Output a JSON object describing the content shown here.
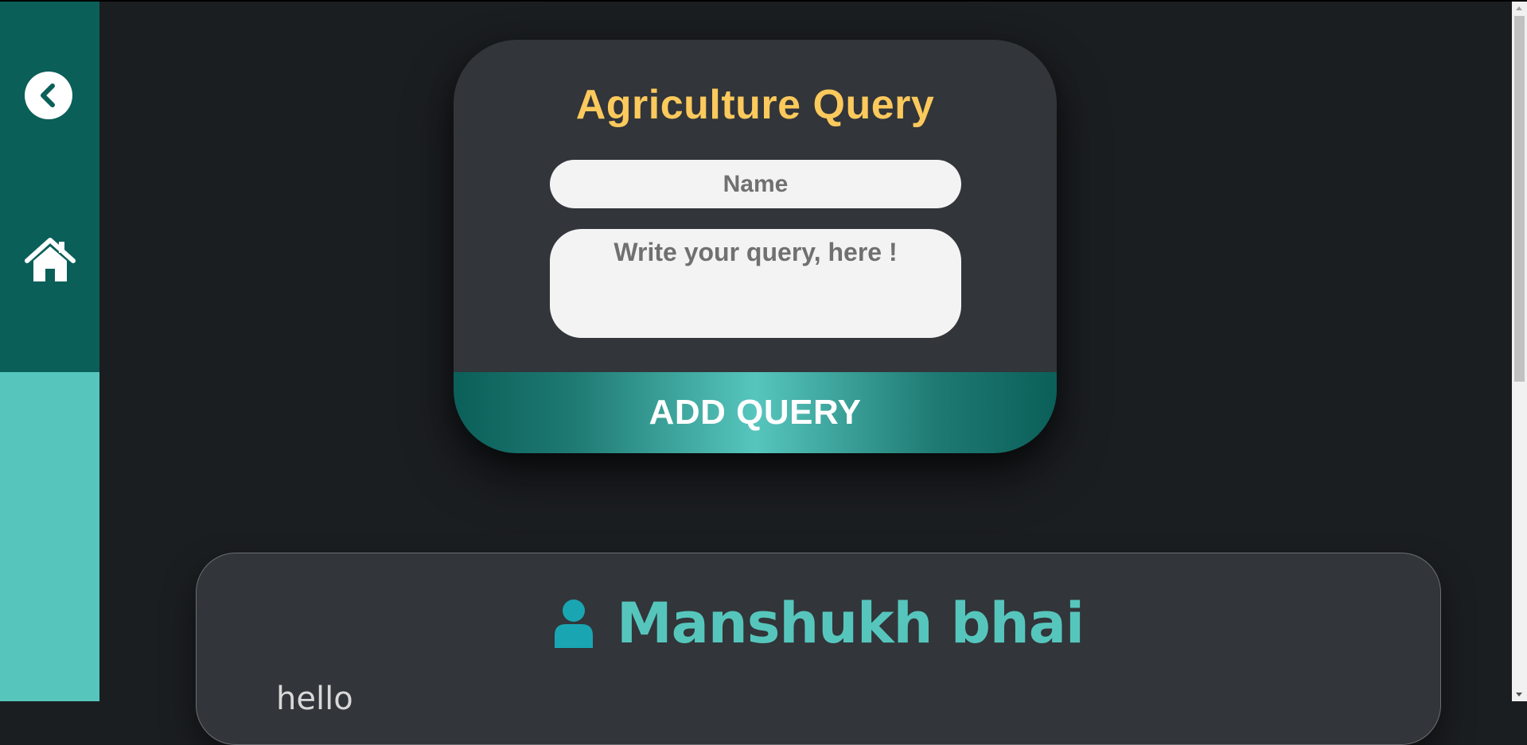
{
  "sidebar": {
    "back_icon": "chevron-left-circle-icon",
    "home_icon": "home-icon"
  },
  "form": {
    "title": "Agriculture Query",
    "name_placeholder": "Name",
    "query_placeholder": "Write your query, here !",
    "submit_label": "ADD QUERY"
  },
  "queries": [
    {
      "user_name": "Manshukh bhai",
      "text": "hello"
    }
  ],
  "colors": {
    "background": "#1b1e21",
    "sidebar_dark": "#0b5f59",
    "sidebar_light": "#56c6bd",
    "card": "#323539",
    "title_accent": "#fbc95c",
    "username_accent": "#56c6bd",
    "user_icon": "#19a6b2"
  }
}
